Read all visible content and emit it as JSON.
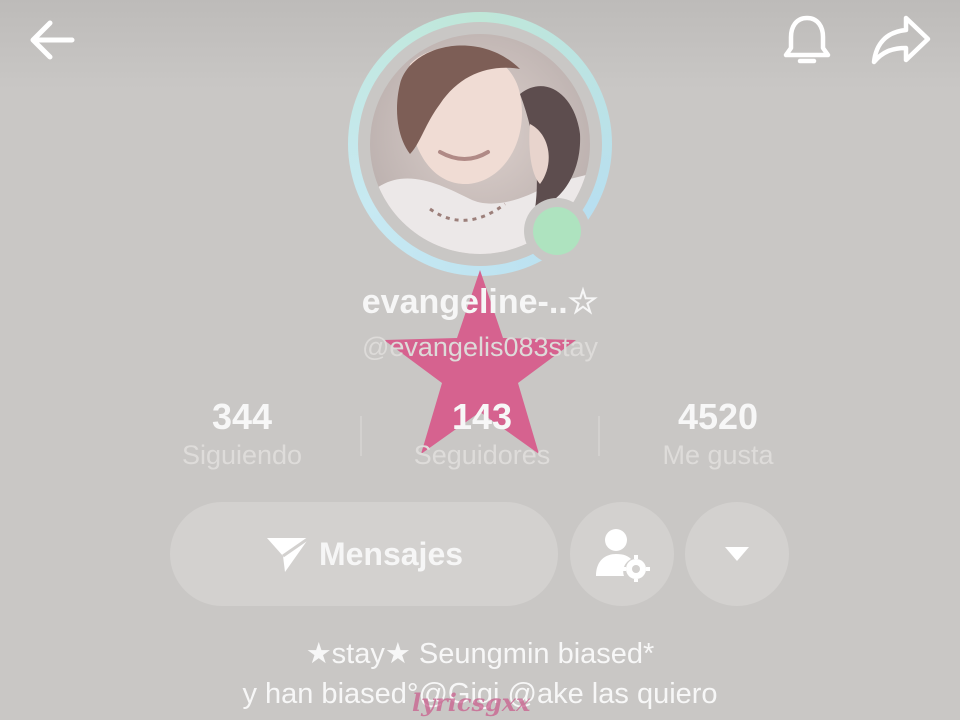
{
  "header": {
    "back_icon": "arrow-left-icon",
    "bell_icon": "bell-icon",
    "share_icon": "share-arrow-icon"
  },
  "profile": {
    "display_name": "evangeline-..☆",
    "handle": "@evangelis083stay",
    "online_indicator_color": "#aee3bf",
    "ring_color": "#b8dff0"
  },
  "stats": [
    {
      "value": "344",
      "label": "Siguiendo"
    },
    {
      "value": "143",
      "label": "Seguidores"
    },
    {
      "value": "4520",
      "label": "Me gusta"
    }
  ],
  "actions": {
    "message_label": "Mensajes",
    "message_icon": "send-icon",
    "friend_settings_icon": "user-settings-icon",
    "more_icon": "triangle-down-icon"
  },
  "bio": {
    "line1": "★stay★ Seungmin biased*",
    "line2": "y han biased°@Gigi @ake las quiero"
  },
  "overlay": {
    "watermark": "lyricsgxx",
    "star_color": "#d6628f"
  }
}
